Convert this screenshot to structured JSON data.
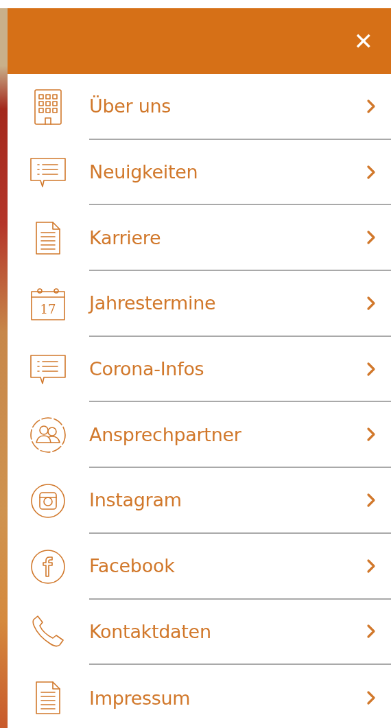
{
  "menu": {
    "close_label": "✕",
    "items": [
      {
        "kind": "building",
        "label": "Über uns"
      },
      {
        "kind": "chat",
        "label": "Neuigkeiten"
      },
      {
        "kind": "document",
        "label": "Karriere"
      },
      {
        "kind": "calendar",
        "icon_text": "17",
        "label": "Jahrestermine"
      },
      {
        "kind": "chat",
        "label": "Corona-Infos"
      },
      {
        "kind": "people",
        "label": "Ansprechpartner"
      },
      {
        "kind": "instagram",
        "label": "Instagram"
      },
      {
        "kind": "facebook",
        "label": "Facebook"
      },
      {
        "kind": "phone",
        "label": "Kontaktdaten"
      },
      {
        "kind": "document",
        "label": "Impressum"
      }
    ]
  }
}
